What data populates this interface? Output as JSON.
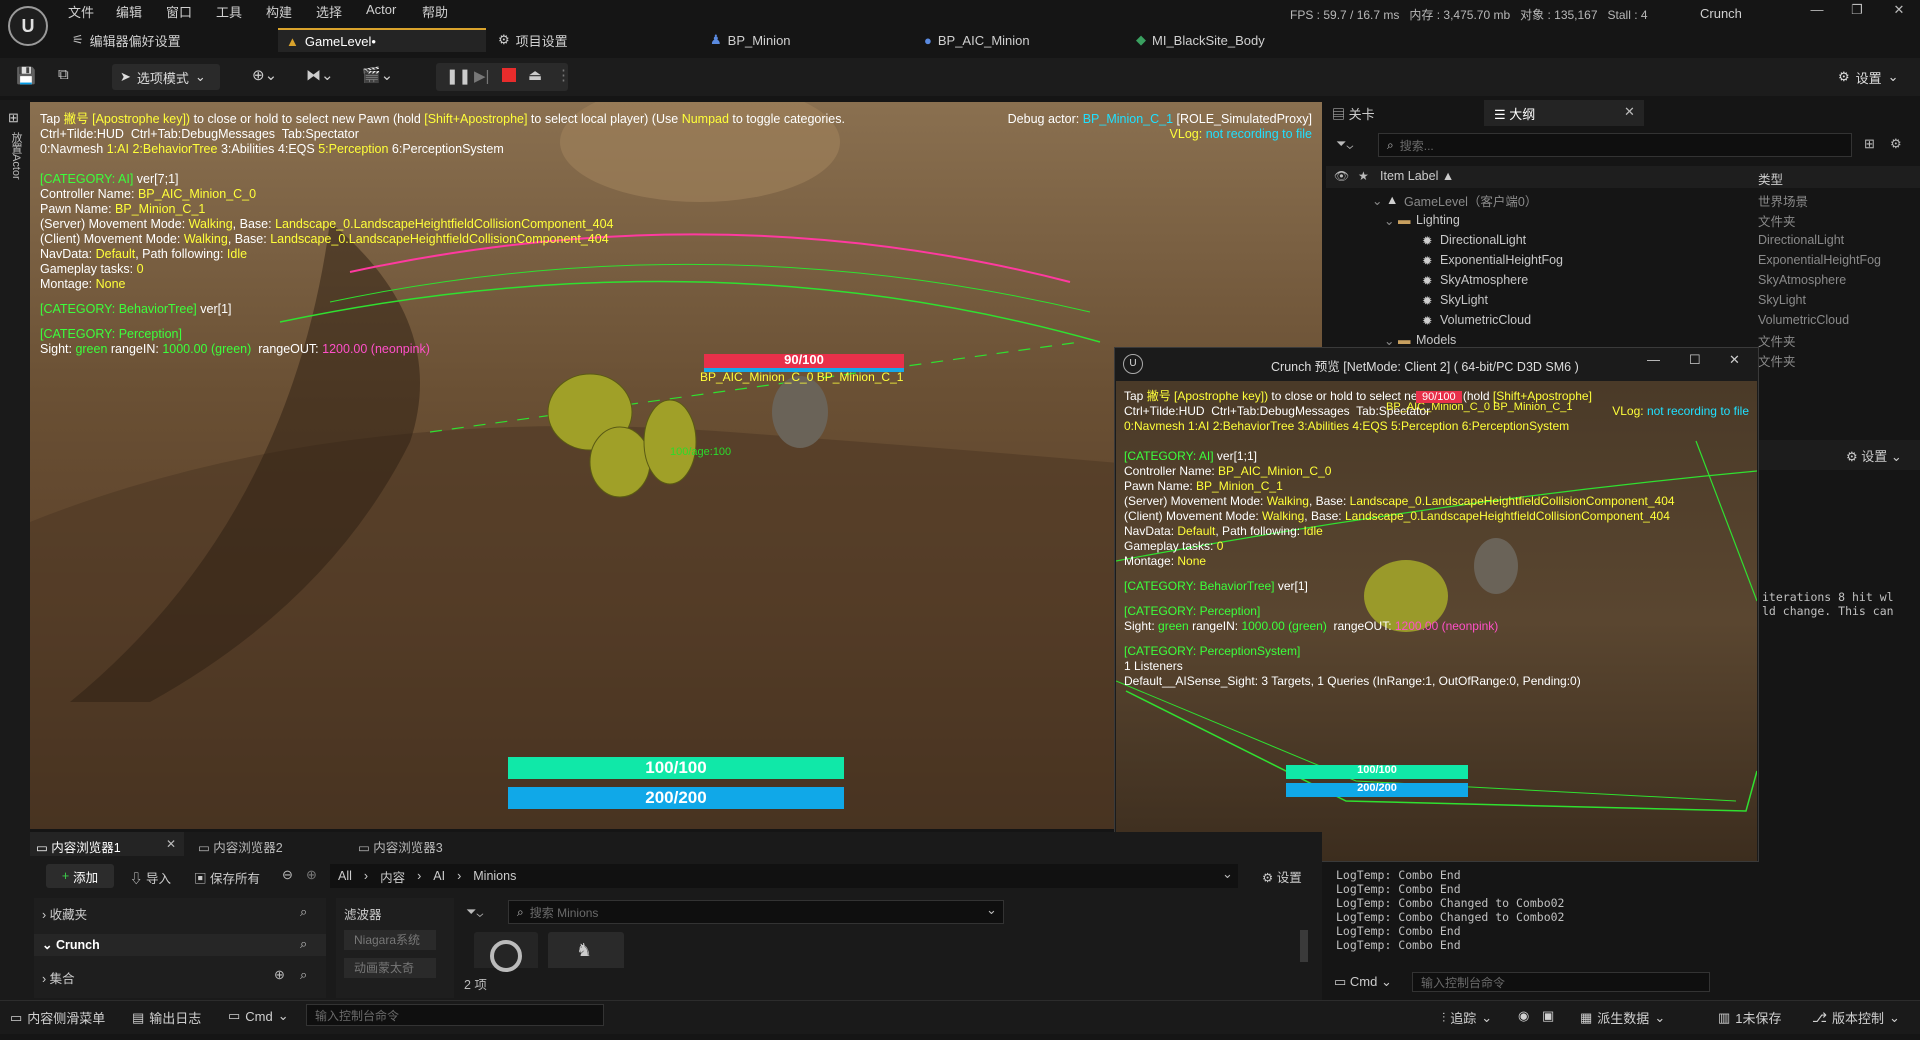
{
  "menu": [
    "文件",
    "编辑",
    "窗口",
    "工具",
    "构建",
    "选择",
    "Actor",
    "帮助"
  ],
  "tabs": [
    {
      "label": "编辑器偏好设置",
      "icon": "sliders-icon"
    },
    {
      "label": "GameLevel•",
      "icon": "level-icon"
    },
    {
      "label": "项目设置",
      "icon": "gear-icon"
    },
    {
      "label": "BP_Minion",
      "icon": "pawn-icon"
    },
    {
      "label": "BP_AIC_Minion",
      "icon": "controller-icon"
    },
    {
      "label": "MI_BlackSite_Body",
      "icon": "material-icon"
    }
  ],
  "stats": {
    "fps": "FPS : 59.7  /  16.7 ms",
    "memory": "内存 : 3,475.70 mb",
    "objects": "对象 : 135,167",
    "stall": "Stall : 4"
  },
  "project_name": "Crunch",
  "toolbar": {
    "mode_label": "选项模式",
    "settings_label": "设置"
  },
  "leftstrip_label": "放置Actor",
  "viewport": {
    "line1a": "Tap ",
    "line1b": "撇号 [Apostrophe key])",
    "line1c": " to close or hold to select new Pawn (hold ",
    "line1d": "[Shift+Apostrophe]",
    "line1e": " to select local player) (Use ",
    "line1f": "Numpad",
    "line1g": " to toggle categories.",
    "line2": "Ctrl+Tilde:HUD  Ctrl+Tab:DebugMessages  Tab:Spectator",
    "cat0": "0:Navmesh",
    "cat1": "1:AI",
    "cat2": "2:BehaviorTree",
    "cat3": "3:Abilities",
    "cat4": "4:EQS",
    "cat5": "5:Perception",
    "cat6": "6:PerceptionSystem",
    "debug_actor_label": "Debug actor: ",
    "debug_actor": "BP_Minion_C_1",
    "debug_role": " [ROLE_SimulatedProxy]",
    "vlog_label": "VLog: ",
    "vlog_value": "not recording to file",
    "ai_cat": "[CATEGORY: AI]",
    "ai_ver": " ver[7;1]",
    "controller_label": "Controller Name: ",
    "controller": "BP_AIC_Minion_C_0",
    "pawn_label": "Pawn Name: ",
    "pawn": "BP_Minion_C_1",
    "server_label": "(Server) Movement Mode: ",
    "server_mode": "Walking",
    "base_label": ", Base: ",
    "server_base": "Landscape_0.LandscapeHeightfieldCollisionComponent_404",
    "client_label": "(Client) Movement Mode: ",
    "client_mode": "Walking",
    "client_base": "Landscape_0.LandscapeHeightfieldCollisionComponent_404",
    "nav_label": "NavData: ",
    "nav": "Default",
    "path_label": ", Path following: ",
    "path": "Idle",
    "gt_label": "Gameplay tasks: ",
    "gt": "0",
    "montage_label": "Montage: ",
    "montage": "None",
    "bt_cat": "[CATEGORY: BehaviorTree]",
    "bt_ver": " ver[1]",
    "perc_cat": "[CATEGORY: Perception]",
    "sight_label": "Sight: ",
    "sight_green": "green",
    "range_in_label": " rangeIN: ",
    "range_in": "1000.00 (green)",
    "range_out_label": "  rangeOUT: ",
    "range_out": "1200.00 (neonpink)",
    "unit_health": "90/100",
    "unit_label": "BP_AIC_Minion_C_0 BP_Minion_C_1",
    "ground_text": "100/age:100",
    "health": "100/100",
    "mana": "200/200"
  },
  "right": {
    "tab_levels": "关卡",
    "tab_outliner": "大纲",
    "search_placeholder": "搜索...",
    "col_label": "Item Label ▲",
    "col_type": "类型",
    "rows": [
      {
        "label": "GameLevel（客户端0）",
        "type": "世界场景",
        "icon": "level-icon"
      },
      {
        "label": "Lighting",
        "type": "文件夹",
        "icon": "folder-icon"
      },
      {
        "label": "DirectionalLight",
        "type": "DirectionalLight",
        "icon": "sun-icon"
      },
      {
        "label": "ExponentialHeightFog",
        "type": "ExponentialHeightFog",
        "icon": "fog-icon"
      },
      {
        "label": "SkyAtmosphere",
        "type": "SkyAtmosphere",
        "icon": "atmosphere-icon"
      },
      {
        "label": "SkyLight",
        "type": "SkyLight",
        "icon": "skylight-icon"
      },
      {
        "label": "VolumetricCloud",
        "type": "VolumetricCloud",
        "icon": "cloud-icon"
      },
      {
        "label": "Models",
        "type": "文件夹",
        "icon": "folder-icon"
      },
      {
        "label": "",
        "type": "文件夹",
        "icon": ""
      }
    ],
    "details_settings": "设置",
    "output_snippet_1": "iterations 8 hit wl",
    "output_snippet_2": "ld change. This can",
    "log_lines": [
      "LogTemp: Combo End",
      "LogTemp: Combo End",
      "LogTemp: Combo Changed to Combo02",
      "LogTemp: Combo Changed to Combo02",
      "LogTemp: Combo End",
      "LogTemp: Combo End"
    ],
    "cmd_label": "Cmd",
    "cmd_placeholder": "输入控制台命令"
  },
  "float": {
    "title": "Crunch 预览 [NetMode: Client 2]  ( 64-bit/PC D3D SM6 )",
    "line1a": "Tap ",
    "line1b": "撇号 [Apostrophe key])",
    "line1c": " to close or hold to select new Pawn (hold ",
    "line1d": "[Shift+Apostrophe]",
    "line2": "Ctrl+Tilde:HUD  Ctrl+Tab:DebugMessages  Tab:Spectator",
    "cats": "0:Navmesh 1:AI 2:BehaviorTree 3:Abilities 4:EQS 5:Perception 6:PerceptionSystem",
    "vlog_label": "VLog: ",
    "vlog_value": "not recording to file",
    "ai_cat": "[CATEGORY: AI]",
    "ai_ver": " ver[1;1]",
    "controller": "BP_AIC_Minion_C_0",
    "pawn": "BP_Minion_C_1",
    "server_base": "Landscape_0.LandscapeHeightfieldCollisionComponent_404",
    "client_base": "Landscape_0.LandscapeHeightfieldCollisionComponent_404",
    "percsys_cat": "[CATEGORY: PerceptionSystem]",
    "listeners": "1 Listeners",
    "sense": "Default__AISense_Sight: 3 Targets, 1 Queries (InRange:1, OutOfRange:0, Pending:0)",
    "range_out": "1200.00 (neonpink)",
    "health": "100/100",
    "mana": "200/200",
    "unit_label": "BP_AIC_Minion_C_0 BP_Minion_C_1",
    "unit_health": "90/100"
  },
  "content_browser": {
    "tabs": [
      "内容浏览器1",
      "内容浏览器2",
      "内容浏览器3"
    ],
    "add": "添加",
    "import": "导入",
    "save_all": "保存所有",
    "path": [
      "All",
      "内容",
      "AI",
      "Minions"
    ],
    "settings": "设置",
    "favorites": "收藏夹",
    "project": "Crunch",
    "collections": "集合",
    "filters": "滤波器",
    "filter_items": [
      "Niagara系统",
      "动画蒙太奇"
    ],
    "search_placeholder": "搜索 Minions",
    "item_count": "2 项"
  },
  "status": {
    "drawer": "内容侧滑菜单",
    "output_log": "输出日志",
    "cmd": "Cmd",
    "cmd_placeholder": "输入控制台命令",
    "trace": "追踪",
    "derived": "派生数据",
    "unsaved": "1未保存",
    "source_control": "版本控制"
  },
  "colors": {
    "accent": "#d9a32c",
    "debug_yellow": "#ffff3a",
    "debug_green": "#3cff3c",
    "debug_cyan": "#20e0ff",
    "health_bar": "#10e8a8",
    "mana_bar": "#10a8e8"
  }
}
